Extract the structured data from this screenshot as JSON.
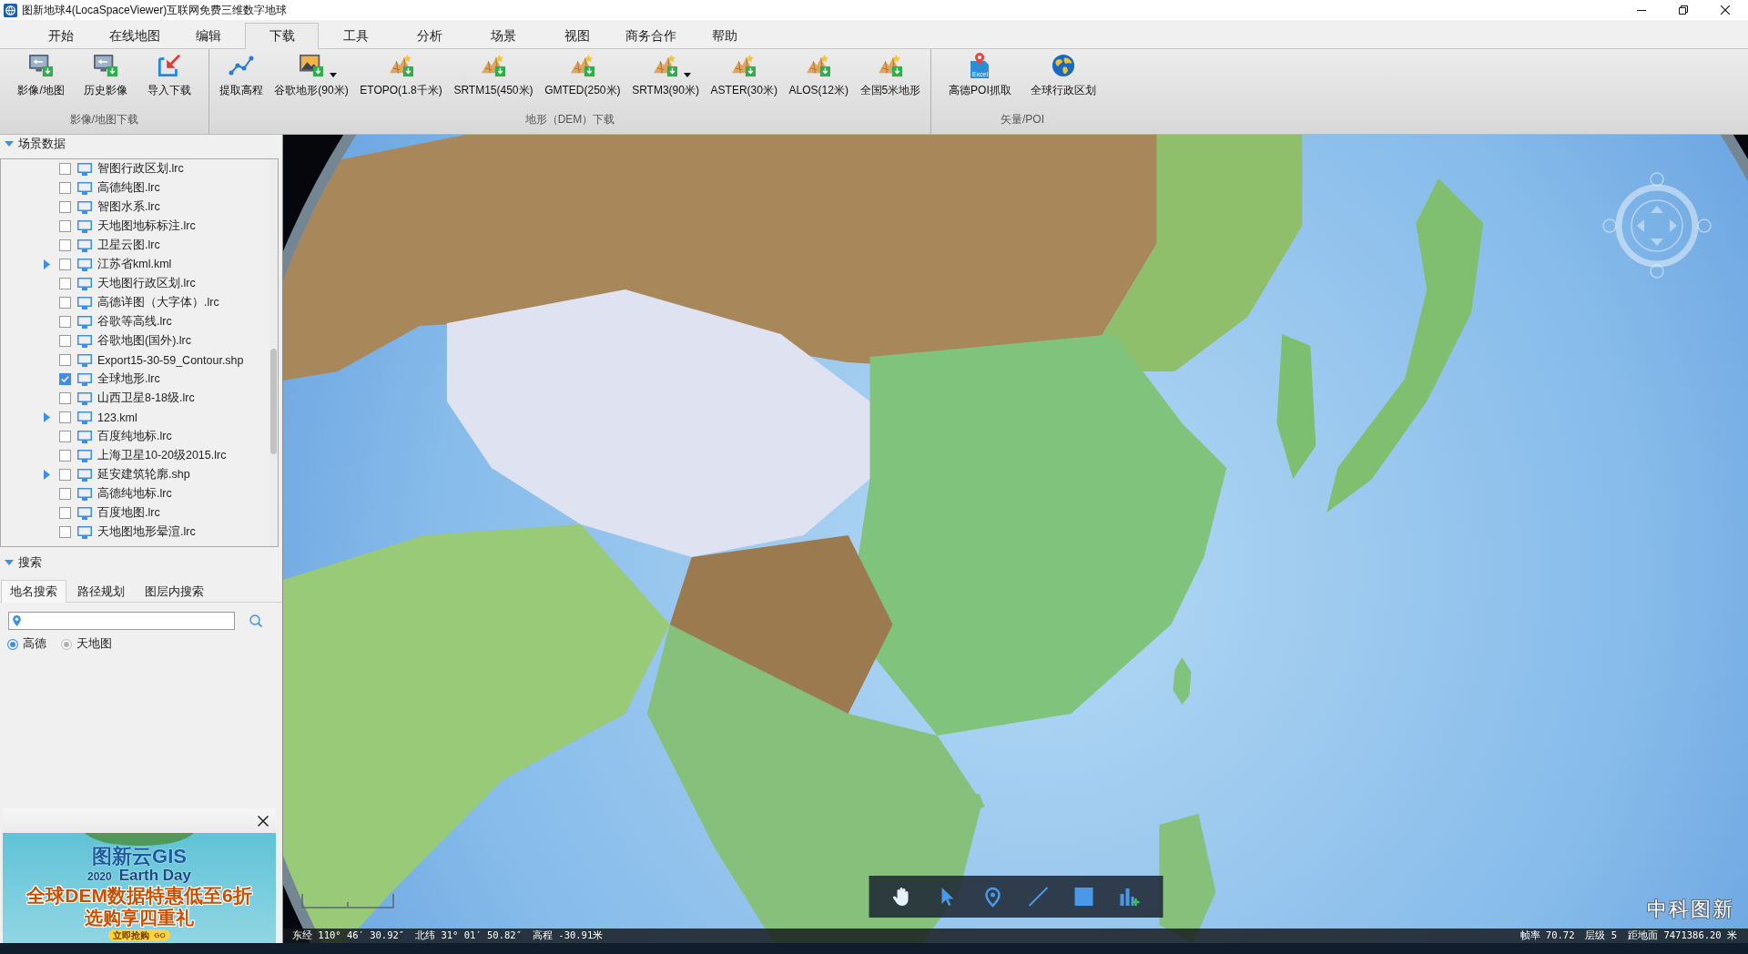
{
  "window": {
    "title": "图新地球4(LocaSpaceViewer)互联网免费三维数字地球"
  },
  "menu_tabs": [
    {
      "label": "开始",
      "selected": false
    },
    {
      "label": "在线地图",
      "selected": false
    },
    {
      "label": "编辑",
      "selected": false
    },
    {
      "label": "下载",
      "selected": true
    },
    {
      "label": "工具",
      "selected": false
    },
    {
      "label": "分析",
      "selected": false
    },
    {
      "label": "场景",
      "selected": false
    },
    {
      "label": "视图",
      "selected": false
    },
    {
      "label": "商务合作",
      "selected": false
    },
    {
      "label": "帮助",
      "selected": false
    }
  ],
  "ribbon": {
    "groups": [
      {
        "label": "影像/地图下载",
        "buttons": [
          {
            "label": "影像/地图",
            "kind": "monitor-download",
            "dropdown": false
          },
          {
            "label": "历史影像",
            "kind": "monitor-download",
            "dropdown": false
          },
          {
            "label": "导入下载",
            "kind": "import",
            "dropdown": false
          }
        ]
      },
      {
        "label": "地形（DEM）下载",
        "buttons": [
          {
            "label": "提取高程",
            "kind": "elevation",
            "dropdown": false
          },
          {
            "label": "谷歌地形(90米)",
            "kind": "picture-download",
            "dropdown": true
          },
          {
            "label": "ETOPO(1.8千米)",
            "kind": "terrain-download",
            "dropdown": false
          },
          {
            "label": "SRTM15(450米)",
            "kind": "terrain-download",
            "dropdown": false
          },
          {
            "label": "GMTED(250米)",
            "kind": "terrain-download",
            "dropdown": false
          },
          {
            "label": "SRTM3(90米)",
            "kind": "terrain-download",
            "dropdown": true
          },
          {
            "label": "ASTER(30米)",
            "kind": "terrain-download",
            "dropdown": false
          },
          {
            "label": "ALOS(12米)",
            "kind": "terrain-download",
            "dropdown": false
          },
          {
            "label": "全国5米地形",
            "kind": "terrain-download",
            "dropdown": false
          }
        ]
      },
      {
        "label": "矢量/POI",
        "buttons": [
          {
            "label": "高德POI抓取",
            "kind": "excel-poi",
            "icon_text": "Excel",
            "dropdown": false
          },
          {
            "label": "全球行政区划",
            "kind": "globe",
            "dropdown": false
          }
        ]
      }
    ]
  },
  "scene_panel": {
    "title": "场景数据",
    "expanded": true,
    "items": [
      {
        "label": "智图行政区划.lrc",
        "checked": false,
        "has_children": false
      },
      {
        "label": "高德纯图.lrc",
        "checked": false,
        "has_children": false
      },
      {
        "label": "智图水系.lrc",
        "checked": false,
        "has_children": false
      },
      {
        "label": "天地图地标标注.lrc",
        "checked": false,
        "has_children": false
      },
      {
        "label": "卫星云图.lrc",
        "checked": false,
        "has_children": false
      },
      {
        "label": "江苏省kml.kml",
        "checked": false,
        "has_children": true
      },
      {
        "label": "天地图行政区划.lrc",
        "checked": false,
        "has_children": false
      },
      {
        "label": "高德详图（大字体）.lrc",
        "checked": false,
        "has_children": false
      },
      {
        "label": "谷歌等高线.lrc",
        "checked": false,
        "has_children": false
      },
      {
        "label": "谷歌地图(国外).lrc",
        "checked": false,
        "has_children": false
      },
      {
        "label": "Export15-30-59_Contour.shp",
        "checked": false,
        "has_children": false
      },
      {
        "label": "全球地形.lrc",
        "checked": true,
        "has_children": false
      },
      {
        "label": "山西卫星8-18级.lrc",
        "checked": false,
        "has_children": false
      },
      {
        "label": "123.kml",
        "checked": false,
        "has_children": true
      },
      {
        "label": "百度纯地标.lrc",
        "checked": false,
        "has_children": false
      },
      {
        "label": "上海卫星10-20级2015.lrc",
        "checked": false,
        "has_children": false
      },
      {
        "label": "延安建筑轮廓.shp",
        "checked": false,
        "has_children": true
      },
      {
        "label": "高德纯地标.lrc",
        "checked": false,
        "has_children": false
      },
      {
        "label": "百度地图.lrc",
        "checked": false,
        "has_children": false
      },
      {
        "label": "天地图地形晕渲.lrc",
        "checked": false,
        "has_children": false
      }
    ]
  },
  "search_panel": {
    "title": "搜索",
    "expanded": true,
    "tabs": [
      {
        "label": "地名搜索",
        "selected": true
      },
      {
        "label": "路径规划",
        "selected": false
      },
      {
        "label": "图层内搜索",
        "selected": false
      }
    ],
    "providers": [
      {
        "label": "高德",
        "selected": true
      },
      {
        "label": "天地图",
        "selected": false
      }
    ]
  },
  "ad_banner": {
    "brand": "图新云GIS",
    "year": "2020",
    "event": "Earth Day",
    "headline": "全球DEM数据特惠低至6折",
    "subline": "选购享四重礼",
    "cta": "立即抢购",
    "cta_tag": "GO"
  },
  "map": {
    "logo_text": "中科图新"
  },
  "map_tools": [
    {
      "kind": "hand",
      "selected": true
    },
    {
      "kind": "pointer",
      "selected": false
    },
    {
      "kind": "pin",
      "selected": false
    },
    {
      "kind": "line",
      "selected": false
    },
    {
      "kind": "square",
      "selected": false
    },
    {
      "kind": "chart-add",
      "selected": false
    }
  ],
  "status_bar": {
    "left": [
      {
        "label": "东经",
        "value": "110° 46′ 30.92″"
      },
      {
        "label": "北纬",
        "value": "31° 01′ 50.82″"
      },
      {
        "label": "高程",
        "value": "-30.91米"
      }
    ],
    "right": [
      {
        "label": "帧率",
        "value": "70.72"
      },
      {
        "label": "层级",
        "value": "5"
      },
      {
        "label": "距地面",
        "value": "7471386.20 米"
      }
    ]
  }
}
